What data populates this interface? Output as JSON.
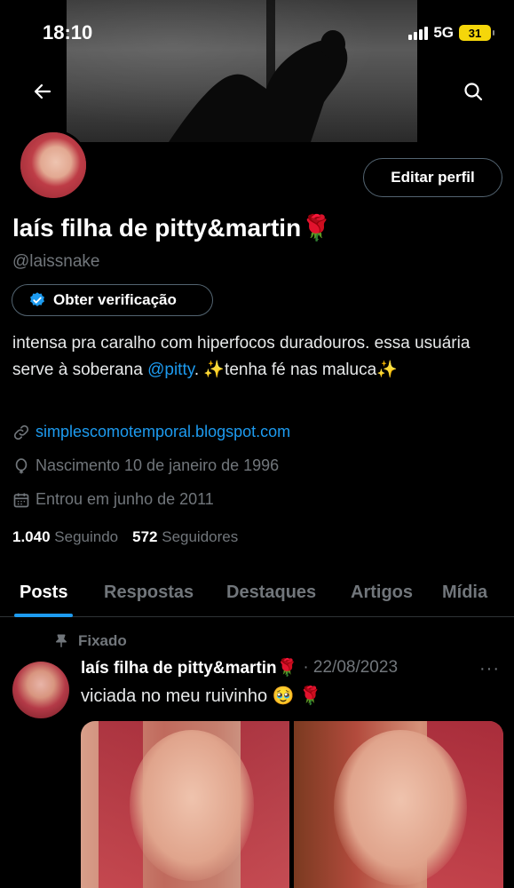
{
  "status_bar": {
    "time": "18:10",
    "network": "5G",
    "battery": "31"
  },
  "profile": {
    "display_name": "laís filha de pitty&martin🌹",
    "handle": "@laissnake",
    "edit_button": "Editar perfil",
    "verify_button": "Obter verificação",
    "bio_part1": "intensa pra caralho com hiperfocos duradouros. essa usuária serve à soberana ",
    "bio_mention": "@pitty",
    "bio_part2": ". ✨tenha fé nas maluca✨",
    "website": "simplescomotemporal.blogspot.com",
    "birth": "Nascimento 10 de janeiro de 1996",
    "joined": "Entrou em junho de 2011",
    "following_count": "1.040",
    "following_label": "Seguindo",
    "followers_count": "572",
    "followers_label": "Seguidores"
  },
  "tabs": [
    {
      "label": "Posts"
    },
    {
      "label": "Respostas"
    },
    {
      "label": "Destaques"
    },
    {
      "label": "Artigos"
    },
    {
      "label": "Mídia"
    }
  ],
  "post": {
    "pinned_label": "Fixado",
    "author": "laís filha de pitty&martin🌹",
    "date": "· 22/08/2023",
    "more": "···",
    "text": "viciada no meu ruivinho 🥹 🌹"
  },
  "colors": {
    "accent": "#1d9bf0",
    "muted": "#71767b",
    "border": "#2f3336",
    "battery": "#f5d60a"
  }
}
